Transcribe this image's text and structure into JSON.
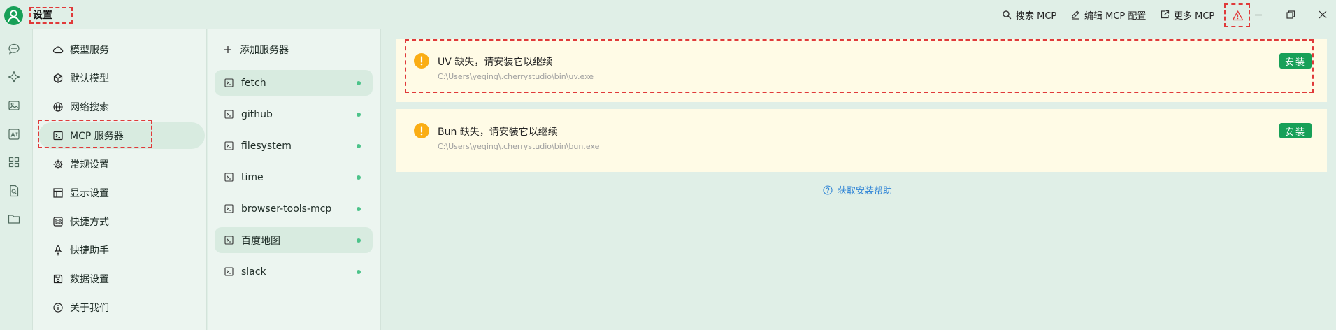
{
  "app": {
    "title": "设置"
  },
  "toolbar": {
    "search_label": "搜索 MCP",
    "edit_label": "编辑 MCP 配置",
    "more_label": "更多 MCP"
  },
  "sidebar": {
    "items": [
      {
        "label": "模型服务",
        "icon": "cloud-icon"
      },
      {
        "label": "默认模型",
        "icon": "cube-icon"
      },
      {
        "label": "网络搜索",
        "icon": "globe-icon"
      },
      {
        "label": "MCP 服务器",
        "icon": "terminal-icon",
        "active": true
      },
      {
        "label": "常规设置",
        "icon": "gear-icon"
      },
      {
        "label": "显示设置",
        "icon": "layout-icon"
      },
      {
        "label": "快捷方式",
        "icon": "command-icon"
      },
      {
        "label": "快捷助手",
        "icon": "rocket-icon"
      },
      {
        "label": "数据设置",
        "icon": "save-icon"
      },
      {
        "label": "关于我们",
        "icon": "info-icon"
      }
    ]
  },
  "servers": {
    "add_label": "添加服务器",
    "items": [
      {
        "name": "fetch",
        "status": "active",
        "selected": true
      },
      {
        "name": "github",
        "status": "active"
      },
      {
        "name": "filesystem",
        "status": "active"
      },
      {
        "name": "time",
        "status": "active"
      },
      {
        "name": "browser-tools-mcp",
        "status": "active"
      },
      {
        "name": "百度地图",
        "status": "active",
        "selected": true
      },
      {
        "name": "slack",
        "status": "active"
      }
    ]
  },
  "warnings": [
    {
      "title": "UV 缺失，请安装它以继续",
      "path": "C:\\Users\\yeqing\\.cherrystudio\\bin\\uv.exe",
      "button": "安装"
    },
    {
      "title": "Bun 缺失，请安装它以继续",
      "path": "C:\\Users\\yeqing\\.cherrystudio\\bin\\bun.exe",
      "button": "安装"
    }
  ],
  "help": {
    "label": "获取安装帮助"
  },
  "colors": {
    "accent": "#18a058",
    "warning": "#faad14",
    "alert": "#e03a3a",
    "link": "#2f84d6",
    "background": "#e0efe7",
    "panel": "#ecf5f0",
    "card": "#fffbe6"
  }
}
